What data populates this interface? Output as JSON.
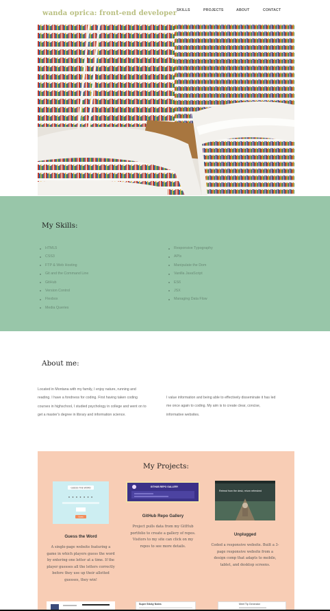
{
  "header": {
    "brand": "wanda oprica: front-end developer",
    "nav": [
      {
        "label": "SKILLS"
      },
      {
        "label": "PROJECTS"
      },
      {
        "label": "ABOUT"
      },
      {
        "label": "CONTACT"
      }
    ]
  },
  "skills": {
    "title": "My Skills:",
    "left": [
      "HTML5",
      "CSS3",
      "FTP & Web Hosting",
      "Git and the Command Line",
      "GitHub",
      "Version Control",
      "Flexbox",
      "Media Queries"
    ],
    "right": [
      "Responsive Typography",
      "APIs",
      "Manipulate the Dom",
      "Vanilla JavaScript",
      "ES6",
      "JSX",
      "Managing Data Flow"
    ]
  },
  "about": {
    "title": "About me:",
    "p1": "Located in Montana with my family, I enjoy nature, running and reading. I have a fondness for coding. First having taken coding courses in highschool, I studied psychology in college and went on to get a master's degree in library and information science.",
    "p2": "I value information and being able to effectively disseminate it has led me once again to coding. My aim is to create clear, concise, informative websites."
  },
  "projects": {
    "title": "My Projects:",
    "items": [
      {
        "title": "Guess the Word",
        "desc": "A single-page website featuring a game in which players guess the word by entering one letter at a time. If the player guesses all the letters correctly before they use up their allotted guesses, they win!",
        "thumb_title": "GUESS THE WORD",
        "thumb_button": "Guess"
      },
      {
        "title": "GitHub Repo Gallery",
        "desc": "Project pulls data from my GitHub portfolio to create a gallery of repos. Visitors to my site can click on my repos to see more details.",
        "thumb_title": "GITHUB REPO GALLERY"
      },
      {
        "title": "Unplugged",
        "desc": "Coded a responsive website. Built a 3-page responsive website from a design comp that adapts to mobile, tablet, and desktop screens.",
        "thumb_title": "Retreat from the desk, return refreshed"
      }
    ],
    "bottom_thumbs": [
      "",
      "Super Sticky Notes",
      "Meet Tip Generator"
    ]
  },
  "colors": {
    "skills_bg": "#98c6a9",
    "projects_bg": "#f8cdb5",
    "brand": "#b9bf80"
  }
}
